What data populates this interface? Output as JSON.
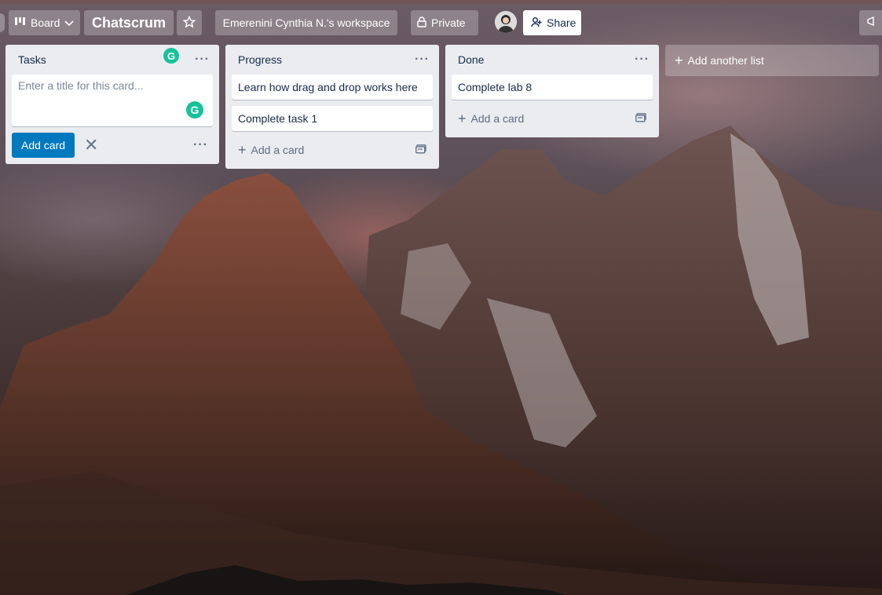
{
  "topbar": {
    "board_menu_label": "Board",
    "board_title": "Chatscrum",
    "workspace_label": "Emerenini Cynthia N.'s workspace",
    "visibility_label": "Private",
    "share_label": "Share"
  },
  "lists": [
    {
      "title": "Tasks",
      "composer_placeholder": "Enter a title for this card...",
      "add_card_button": "Add card",
      "cards": []
    },
    {
      "title": "Progress",
      "cards": [
        "Learn how drag and drop works here",
        "Complete task 1"
      ],
      "add_card_label": "Add a card"
    },
    {
      "title": "Done",
      "cards": [
        "Complete lab 8"
      ],
      "add_card_label": "Add a card"
    }
  ],
  "add_list_label": "Add another list",
  "grammarly_badge_letter": "G",
  "colors": {
    "list_bg": "#ebecf0",
    "primary_button": "#0079bf",
    "grammarly": "#15c39a",
    "text": "#172b4d"
  }
}
